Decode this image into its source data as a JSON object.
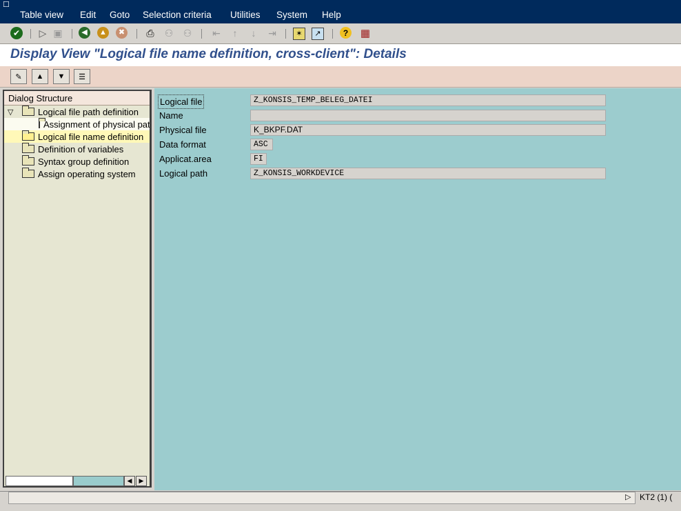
{
  "menu": {
    "items": [
      {
        "label": "Table view"
      },
      {
        "label": "Edit"
      },
      {
        "label": "Goto"
      },
      {
        "label": "Selection criteria"
      },
      {
        "label": "Utilities"
      },
      {
        "label": "System"
      },
      {
        "label": "Help"
      }
    ]
  },
  "title": "Display View \"Logical file name definition, cross-client\": Details",
  "tree": {
    "header": "Dialog Structure",
    "nodes": [
      {
        "label": "Logical file path definition"
      },
      {
        "label": "Assignment of physical paths"
      },
      {
        "label": "Logical file name definition"
      },
      {
        "label": "Definition of variables"
      },
      {
        "label": "Syntax group definition"
      },
      {
        "label": "Assign operating system"
      }
    ]
  },
  "form": {
    "fields": [
      {
        "label": "Logical file",
        "value": "Z_KONSIS_TEMP_BELEG_DATEI"
      },
      {
        "label": "Name",
        "value": ""
      },
      {
        "label": "Physical file",
        "value": "K_BKPF.DAT"
      },
      {
        "label": "Data format",
        "value": "ASC"
      },
      {
        "label": "Applicat.area",
        "value": "FI"
      },
      {
        "label": "Logical path",
        "value": "Z_KONSIS_WORKDEVICE"
      }
    ]
  },
  "status": {
    "system": "KT2 (1) (",
    "message": ""
  },
  "colors": {
    "menubar": "#002a5c",
    "title": "#31508c",
    "work_area": "#9cccce",
    "app_toolbar": "#ecd4c8"
  }
}
